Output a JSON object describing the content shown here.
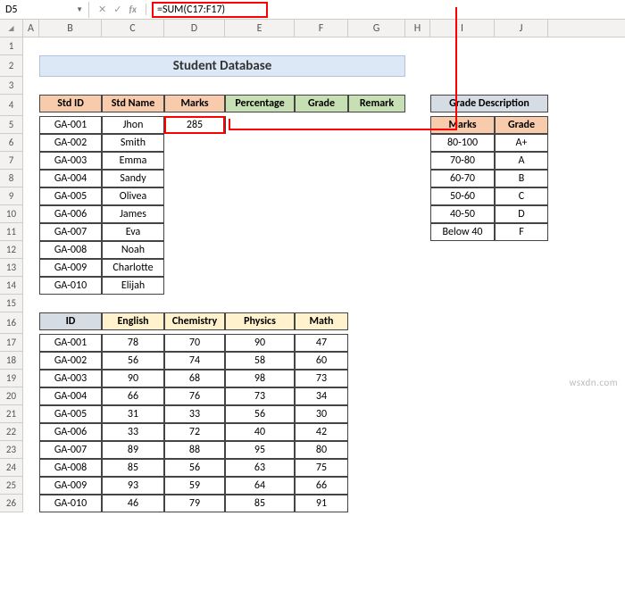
{
  "nameBox": "D5",
  "formula": "=SUM(C17:F17)",
  "colHeaders": [
    "A",
    "B",
    "C",
    "D",
    "E",
    "F",
    "G",
    "H",
    "I",
    "J"
  ],
  "rowHeaders": [
    "1",
    "2",
    "3",
    "4",
    "5",
    "6",
    "7",
    "8",
    "9",
    "10",
    "11",
    "12",
    "13",
    "14",
    "15",
    "16",
    "17",
    "18",
    "19",
    "20",
    "21",
    "22",
    "23",
    "24",
    "25",
    "26"
  ],
  "title": "Student Database",
  "table1": {
    "headers": [
      "Std ID",
      "Std Name",
      "Marks",
      "Percentage",
      "Grade",
      "Remark"
    ],
    "rows": [
      {
        "id": "GA-001",
        "name": "Jhon",
        "marks": "285"
      },
      {
        "id": "GA-002",
        "name": "Smith",
        "marks": ""
      },
      {
        "id": "GA-003",
        "name": "Emma",
        "marks": ""
      },
      {
        "id": "GA-004",
        "name": "Sandy",
        "marks": ""
      },
      {
        "id": "GA-005",
        "name": "Olivea",
        "marks": ""
      },
      {
        "id": "GA-006",
        "name": "James",
        "marks": ""
      },
      {
        "id": "GA-007",
        "name": "Eva",
        "marks": ""
      },
      {
        "id": "GA-008",
        "name": "Noah",
        "marks": ""
      },
      {
        "id": "GA-009",
        "name": "Charlotte",
        "marks": ""
      },
      {
        "id": "GA-010",
        "name": "Elijah",
        "marks": ""
      }
    ]
  },
  "table2": {
    "title": "Grade Description",
    "headers": [
      "Marks",
      "Grade"
    ],
    "rows": [
      {
        "m": "80-100",
        "g": "A+"
      },
      {
        "m": "70-80",
        "g": "A"
      },
      {
        "m": "60-70",
        "g": "B"
      },
      {
        "m": "50-60",
        "g": "C"
      },
      {
        "m": "40-50",
        "g": "D"
      },
      {
        "m": "Below 40",
        "g": "F"
      }
    ]
  },
  "table3": {
    "headers": [
      "ID",
      "English",
      "Chemistry",
      "Physics",
      "Math"
    ],
    "rows": [
      {
        "id": "GA-001",
        "e": "78",
        "c": "70",
        "p": "90",
        "m": "47"
      },
      {
        "id": "GA-002",
        "e": "56",
        "c": "74",
        "p": "58",
        "m": "60"
      },
      {
        "id": "GA-003",
        "e": "90",
        "c": "68",
        "p": "98",
        "m": "73"
      },
      {
        "id": "GA-004",
        "e": "66",
        "c": "76",
        "p": "73",
        "m": "34"
      },
      {
        "id": "GA-005",
        "e": "31",
        "c": "33",
        "p": "56",
        "m": "30"
      },
      {
        "id": "GA-006",
        "e": "33",
        "c": "72",
        "p": "40",
        "m": "42"
      },
      {
        "id": "GA-007",
        "e": "89",
        "c": "88",
        "p": "95",
        "m": "80"
      },
      {
        "id": "GA-008",
        "e": "85",
        "c": "56",
        "p": "63",
        "m": "75"
      },
      {
        "id": "GA-009",
        "e": "93",
        "c": "59",
        "p": "64",
        "m": "66"
      },
      {
        "id": "GA-010",
        "e": "46",
        "c": "79",
        "p": "85",
        "m": "91"
      }
    ]
  },
  "watermark": "wsxdn.com"
}
